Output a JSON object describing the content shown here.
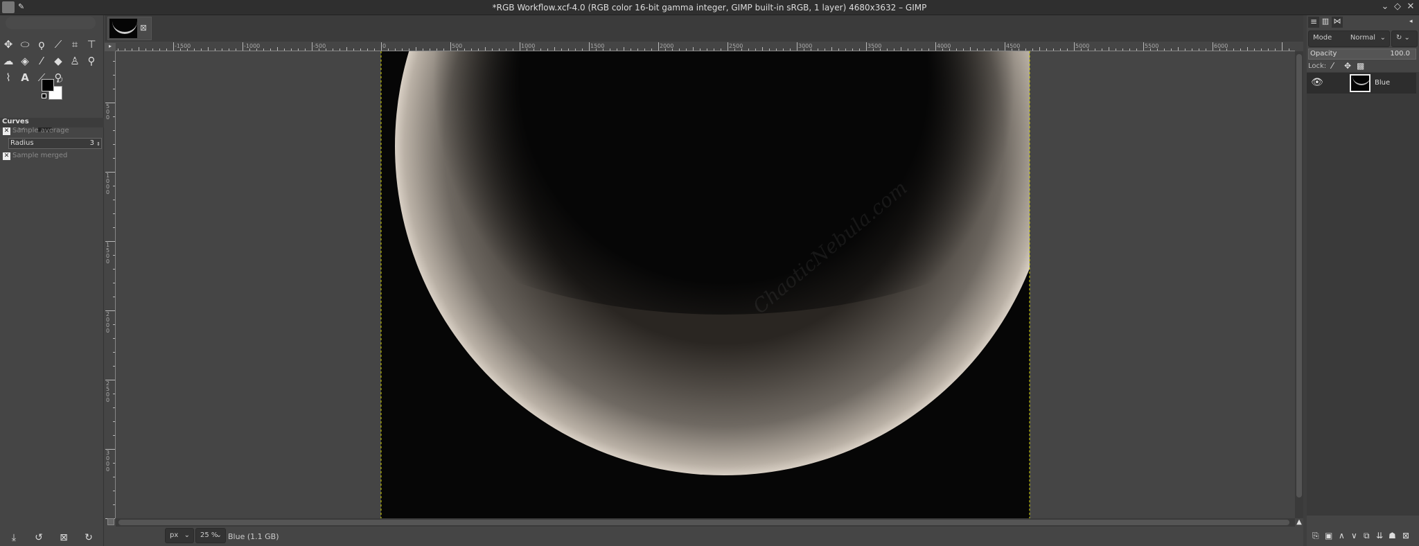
{
  "window": {
    "title": "*RGB Workflow.xcf-4.0 (RGB color 16-bit gamma integer, GIMP built-in sRGB, 1 layer) 4680x3632 – GIMP",
    "controls": [
      "minimize",
      "maximize",
      "close"
    ]
  },
  "toolbox": {
    "tools": [
      "move-tool",
      "ellipse-select-tool",
      "free-select-tool",
      "fuzzy-select-tool",
      "crop-tool",
      "unified-transform-tool",
      "warp-tool",
      "bucket-fill-tool",
      "paintbrush-tool",
      "eraser-tool",
      "clone-tool",
      "smudge-tool",
      "paths-tool",
      "text-tool",
      "color-picker-tool",
      "zoom-tool"
    ],
    "fg_color": "#000000",
    "bg_color": "#ffffff"
  },
  "tool_options": {
    "title": "Curves",
    "sample_average": {
      "label": "Sample average",
      "checked": true
    },
    "radius": {
      "label": "Radius",
      "value": "3"
    },
    "sample_merged": {
      "label": "Sample merged",
      "checked": true
    }
  },
  "rulers": {
    "h_labels": [
      "-1500",
      "-1000",
      "-500",
      "0",
      "500",
      "1000",
      "1500",
      "2000",
      "2500",
      "3000",
      "3500",
      "4000",
      "4500",
      "5000",
      "5500",
      "6000"
    ],
    "v_labels": [
      "500",
      "1000",
      "1500",
      "2000",
      "2500",
      "3000"
    ]
  },
  "canvas": {
    "watermark": "ChaoticNebula.com"
  },
  "status": {
    "unit": "px",
    "zoom": "25 %",
    "info": "Blue (1.1 GB)"
  },
  "layers": {
    "mode_label": "Mode",
    "mode": "Normal",
    "opacity_label": "Opacity",
    "opacity": "100.0",
    "lock_label": "Lock:",
    "items": [
      {
        "name": "Blue",
        "visible": true
      }
    ]
  }
}
